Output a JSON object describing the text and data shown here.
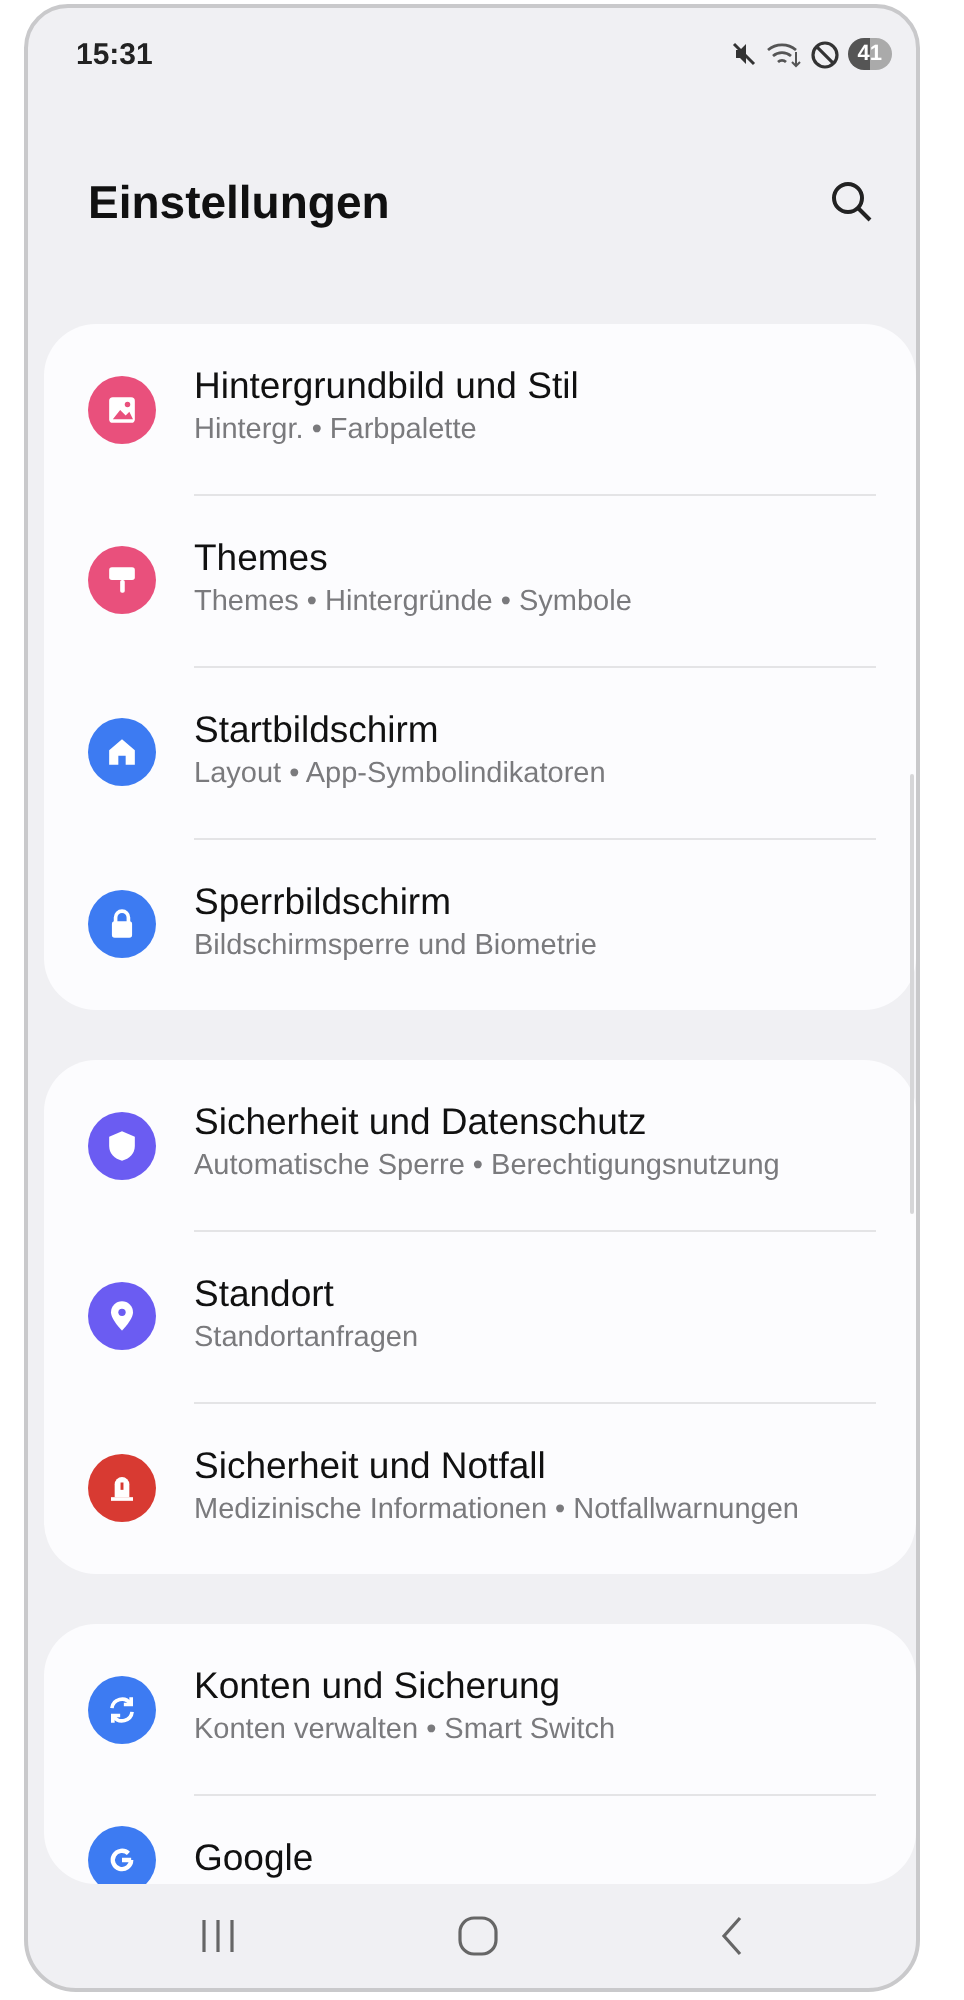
{
  "status_bar": {
    "time": "15:31",
    "battery": "41"
  },
  "header": {
    "title": "Einstellungen"
  },
  "groups": [
    {
      "items": [
        {
          "title": "Hintergrundbild und Stil",
          "subtitle": "Hintergr. • Farbpalette",
          "color": "#e9507c"
        },
        {
          "title": "Themes",
          "subtitle": "Themes • Hintergründe • Symbole",
          "color": "#e9507c"
        },
        {
          "title": "Startbildschirm",
          "subtitle": "Layout • App-Symbolindikatoren",
          "color": "#3d7bf2"
        },
        {
          "title": "Sperrbildschirm",
          "subtitle": "Bildschirmsperre und Biometrie",
          "color": "#3d7bf2"
        }
      ]
    },
    {
      "items": [
        {
          "title": "Sicherheit und Datenschutz",
          "subtitle": "Automatische Sperre • Berechtigungsnutzung",
          "color": "#6b5cf2"
        },
        {
          "title": "Standort",
          "subtitle": "Standortanfragen",
          "color": "#6b5cf2"
        },
        {
          "title": "Sicherheit und Notfall",
          "subtitle": "Medizinische Informationen • Notfallwarnungen",
          "color": "#d83a32"
        }
      ]
    },
    {
      "items": [
        {
          "title": "Konten und Sicherung",
          "subtitle": "Konten verwalten • Smart Switch",
          "color": "#3d7bf2"
        },
        {
          "title": "Google",
          "color": "#3d7bf2"
        }
      ]
    }
  ]
}
